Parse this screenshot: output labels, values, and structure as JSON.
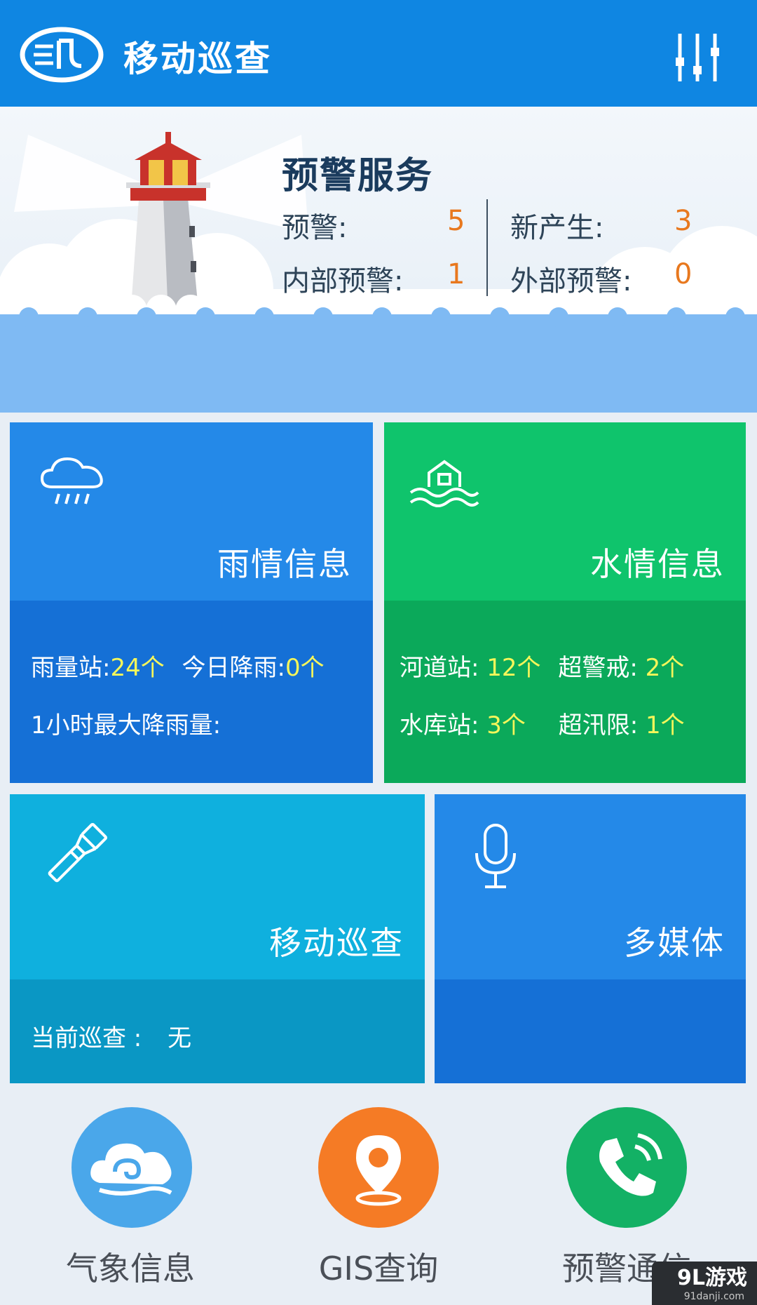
{
  "header": {
    "title": "移动巡查"
  },
  "banner": {
    "title": "预警服务",
    "stats": [
      {
        "label": "预警:",
        "value": "5"
      },
      {
        "label": "新产生:",
        "value": "3"
      },
      {
        "label": "内部预警:",
        "value": "1"
      },
      {
        "label": "外部预警:",
        "value": "0"
      }
    ]
  },
  "tiles": {
    "rain": {
      "title": "雨情信息",
      "line1": {
        "label1": "雨量站:",
        "value1": "24个",
        "label2": "今日降雨:",
        "value2": "0个"
      },
      "line2": {
        "label": "1小时最大降雨量:"
      }
    },
    "water": {
      "title": "水情信息",
      "line1": {
        "label1": "河道站: ",
        "value1": "12个",
        "label2": "超警戒: ",
        "value2": "2个"
      },
      "line2": {
        "label1": "水库站: ",
        "value1": "3个",
        "label2": "超汛限: ",
        "value2": "1个"
      }
    },
    "patrol": {
      "title": "移动巡查",
      "line1": {
        "label": "当前巡查 :",
        "value": "无"
      }
    },
    "media": {
      "title": "多媒体"
    }
  },
  "bottom_nav": [
    {
      "label": "气象信息",
      "icon": "cloud-icon",
      "color": "#4aa7ea"
    },
    {
      "label": "GIS查询",
      "icon": "map-pin-icon",
      "color": "#f57b25"
    },
    {
      "label": "预警通信",
      "icon": "phone-icon",
      "color": "#13b165"
    }
  ],
  "watermark": {
    "text": "9L游戏",
    "sub": "91danji.com"
  },
  "colors": {
    "header": "#0f86e2",
    "rain_top": "#2489e8",
    "rain_bottom": "#1570d6",
    "water_top": "#0fc46c",
    "water_bottom": "#0ba95a",
    "patrol_top": "#0fb0de",
    "patrol_bottom": "#0a97c4",
    "media_top": "#2489e8",
    "media_bottom": "#1570d6",
    "value_orange": "#e8781e",
    "value_yellow": "#f6f65a"
  }
}
